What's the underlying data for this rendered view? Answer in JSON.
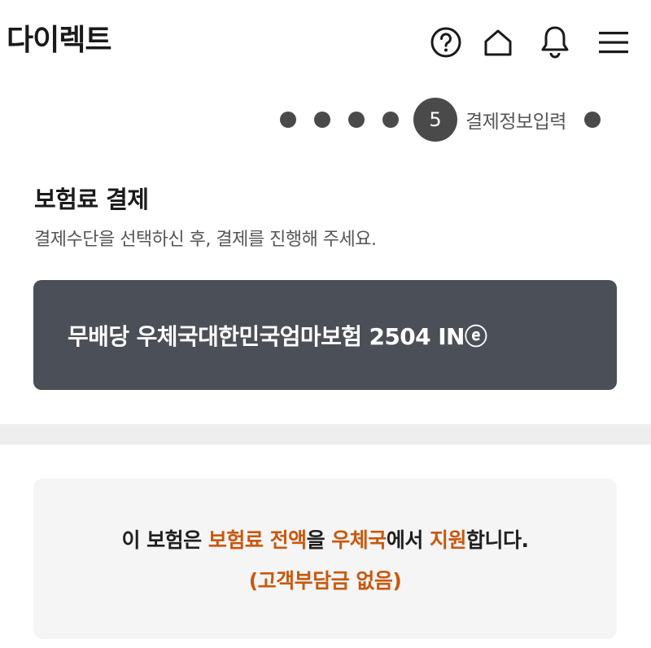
{
  "header": {
    "logo": "다이렉트",
    "icons": [
      "help-icon",
      "home-icon",
      "bell-icon",
      "menu-icon"
    ]
  },
  "stepper": {
    "completed_steps": 4,
    "current_step": "5",
    "current_label": "결제정보입력",
    "remaining_steps": 1
  },
  "section": {
    "title": "보험료 결제",
    "subtitle": "결제수단을 선택하신 후, 결제를 진행해 주세요."
  },
  "product": {
    "name": "무배당 우체국대한민국엄마보험 2504 IN",
    "badge": "ⓔ"
  },
  "notice": {
    "p1": "이 보험은 ",
    "h1": "보험료 전액",
    "p2": "을 ",
    "h2": "우체국",
    "p3": "에서 ",
    "h3": "지원",
    "p4": "합니다.",
    "line2": "(고객부담금 없음)"
  },
  "colors": {
    "accent": "#c9580e",
    "card_dark": "#4b4f57",
    "step_dot": "#4a4a4a"
  }
}
